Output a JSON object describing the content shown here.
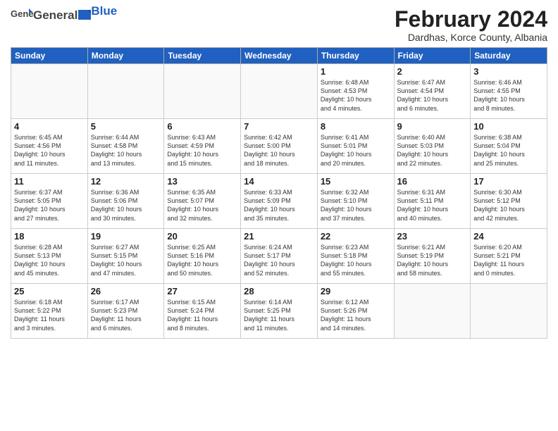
{
  "header": {
    "logo_general": "General",
    "logo_blue": "Blue",
    "title": "February 2024",
    "subtitle": "Dardhas, Korce County, Albania"
  },
  "weekdays": [
    "Sunday",
    "Monday",
    "Tuesday",
    "Wednesday",
    "Thursday",
    "Friday",
    "Saturday"
  ],
  "weeks": [
    [
      {
        "day": "",
        "info": ""
      },
      {
        "day": "",
        "info": ""
      },
      {
        "day": "",
        "info": ""
      },
      {
        "day": "",
        "info": ""
      },
      {
        "day": "1",
        "info": "Sunrise: 6:48 AM\nSunset: 4:53 PM\nDaylight: 10 hours\nand 4 minutes."
      },
      {
        "day": "2",
        "info": "Sunrise: 6:47 AM\nSunset: 4:54 PM\nDaylight: 10 hours\nand 6 minutes."
      },
      {
        "day": "3",
        "info": "Sunrise: 6:46 AM\nSunset: 4:55 PM\nDaylight: 10 hours\nand 8 minutes."
      }
    ],
    [
      {
        "day": "4",
        "info": "Sunrise: 6:45 AM\nSunset: 4:56 PM\nDaylight: 10 hours\nand 11 minutes."
      },
      {
        "day": "5",
        "info": "Sunrise: 6:44 AM\nSunset: 4:58 PM\nDaylight: 10 hours\nand 13 minutes."
      },
      {
        "day": "6",
        "info": "Sunrise: 6:43 AM\nSunset: 4:59 PM\nDaylight: 10 hours\nand 15 minutes."
      },
      {
        "day": "7",
        "info": "Sunrise: 6:42 AM\nSunset: 5:00 PM\nDaylight: 10 hours\nand 18 minutes."
      },
      {
        "day": "8",
        "info": "Sunrise: 6:41 AM\nSunset: 5:01 PM\nDaylight: 10 hours\nand 20 minutes."
      },
      {
        "day": "9",
        "info": "Sunrise: 6:40 AM\nSunset: 5:03 PM\nDaylight: 10 hours\nand 22 minutes."
      },
      {
        "day": "10",
        "info": "Sunrise: 6:38 AM\nSunset: 5:04 PM\nDaylight: 10 hours\nand 25 minutes."
      }
    ],
    [
      {
        "day": "11",
        "info": "Sunrise: 6:37 AM\nSunset: 5:05 PM\nDaylight: 10 hours\nand 27 minutes."
      },
      {
        "day": "12",
        "info": "Sunrise: 6:36 AM\nSunset: 5:06 PM\nDaylight: 10 hours\nand 30 minutes."
      },
      {
        "day": "13",
        "info": "Sunrise: 6:35 AM\nSunset: 5:07 PM\nDaylight: 10 hours\nand 32 minutes."
      },
      {
        "day": "14",
        "info": "Sunrise: 6:33 AM\nSunset: 5:09 PM\nDaylight: 10 hours\nand 35 minutes."
      },
      {
        "day": "15",
        "info": "Sunrise: 6:32 AM\nSunset: 5:10 PM\nDaylight: 10 hours\nand 37 minutes."
      },
      {
        "day": "16",
        "info": "Sunrise: 6:31 AM\nSunset: 5:11 PM\nDaylight: 10 hours\nand 40 minutes."
      },
      {
        "day": "17",
        "info": "Sunrise: 6:30 AM\nSunset: 5:12 PM\nDaylight: 10 hours\nand 42 minutes."
      }
    ],
    [
      {
        "day": "18",
        "info": "Sunrise: 6:28 AM\nSunset: 5:13 PM\nDaylight: 10 hours\nand 45 minutes."
      },
      {
        "day": "19",
        "info": "Sunrise: 6:27 AM\nSunset: 5:15 PM\nDaylight: 10 hours\nand 47 minutes."
      },
      {
        "day": "20",
        "info": "Sunrise: 6:25 AM\nSunset: 5:16 PM\nDaylight: 10 hours\nand 50 minutes."
      },
      {
        "day": "21",
        "info": "Sunrise: 6:24 AM\nSunset: 5:17 PM\nDaylight: 10 hours\nand 52 minutes."
      },
      {
        "day": "22",
        "info": "Sunrise: 6:23 AM\nSunset: 5:18 PM\nDaylight: 10 hours\nand 55 minutes."
      },
      {
        "day": "23",
        "info": "Sunrise: 6:21 AM\nSunset: 5:19 PM\nDaylight: 10 hours\nand 58 minutes."
      },
      {
        "day": "24",
        "info": "Sunrise: 6:20 AM\nSunset: 5:21 PM\nDaylight: 11 hours\nand 0 minutes."
      }
    ],
    [
      {
        "day": "25",
        "info": "Sunrise: 6:18 AM\nSunset: 5:22 PM\nDaylight: 11 hours\nand 3 minutes."
      },
      {
        "day": "26",
        "info": "Sunrise: 6:17 AM\nSunset: 5:23 PM\nDaylight: 11 hours\nand 6 minutes."
      },
      {
        "day": "27",
        "info": "Sunrise: 6:15 AM\nSunset: 5:24 PM\nDaylight: 11 hours\nand 8 minutes."
      },
      {
        "day": "28",
        "info": "Sunrise: 6:14 AM\nSunset: 5:25 PM\nDaylight: 11 hours\nand 11 minutes."
      },
      {
        "day": "29",
        "info": "Sunrise: 6:12 AM\nSunset: 5:26 PM\nDaylight: 11 hours\nand 14 minutes."
      },
      {
        "day": "",
        "info": ""
      },
      {
        "day": "",
        "info": ""
      }
    ]
  ]
}
